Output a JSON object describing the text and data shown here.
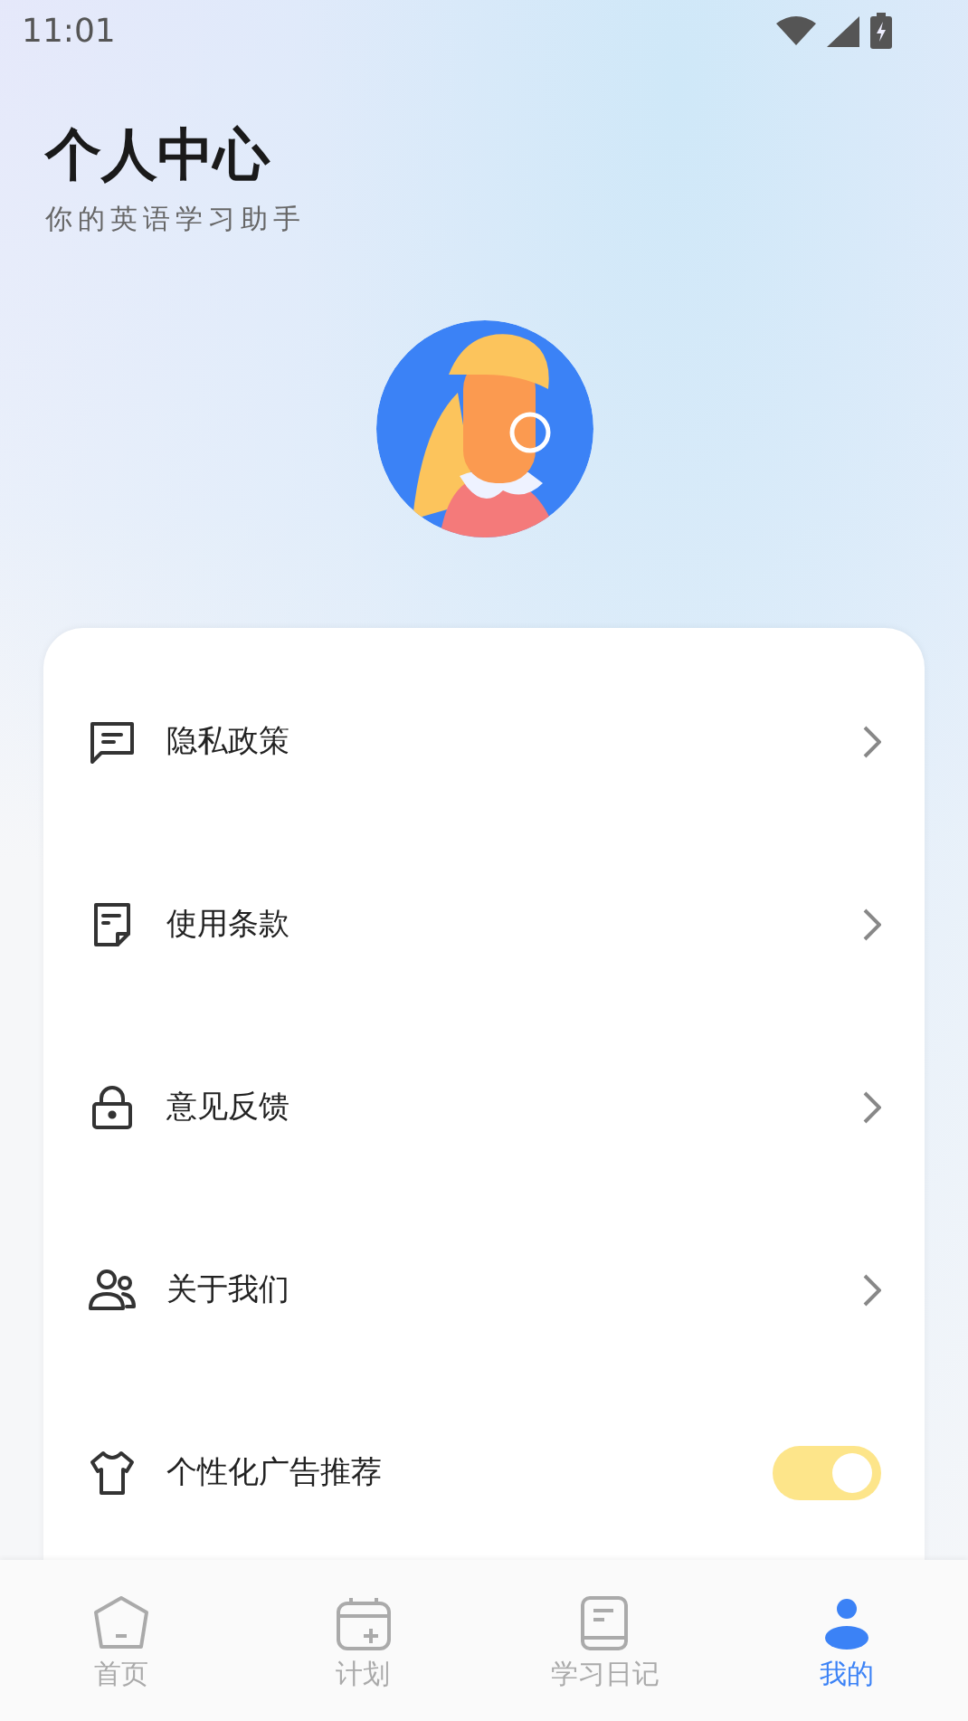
{
  "status_bar": {
    "time": "11:01"
  },
  "header": {
    "title": "个人中心",
    "subtitle": "你的英语学习助手"
  },
  "menu": [
    {
      "kind": "link",
      "label": "隐私政策"
    },
    {
      "kind": "link",
      "label": "使用条款"
    },
    {
      "kind": "link",
      "label": "意见反馈"
    },
    {
      "kind": "link",
      "label": "关于我们"
    },
    {
      "kind": "toggle",
      "label": "个性化广告推荐",
      "on": true
    }
  ],
  "tab_bar": [
    {
      "label": "首页",
      "selected": false
    },
    {
      "label": "计划",
      "selected": false
    },
    {
      "label": "学习日记",
      "selected": false
    },
    {
      "label": "我的",
      "selected": true
    }
  ]
}
